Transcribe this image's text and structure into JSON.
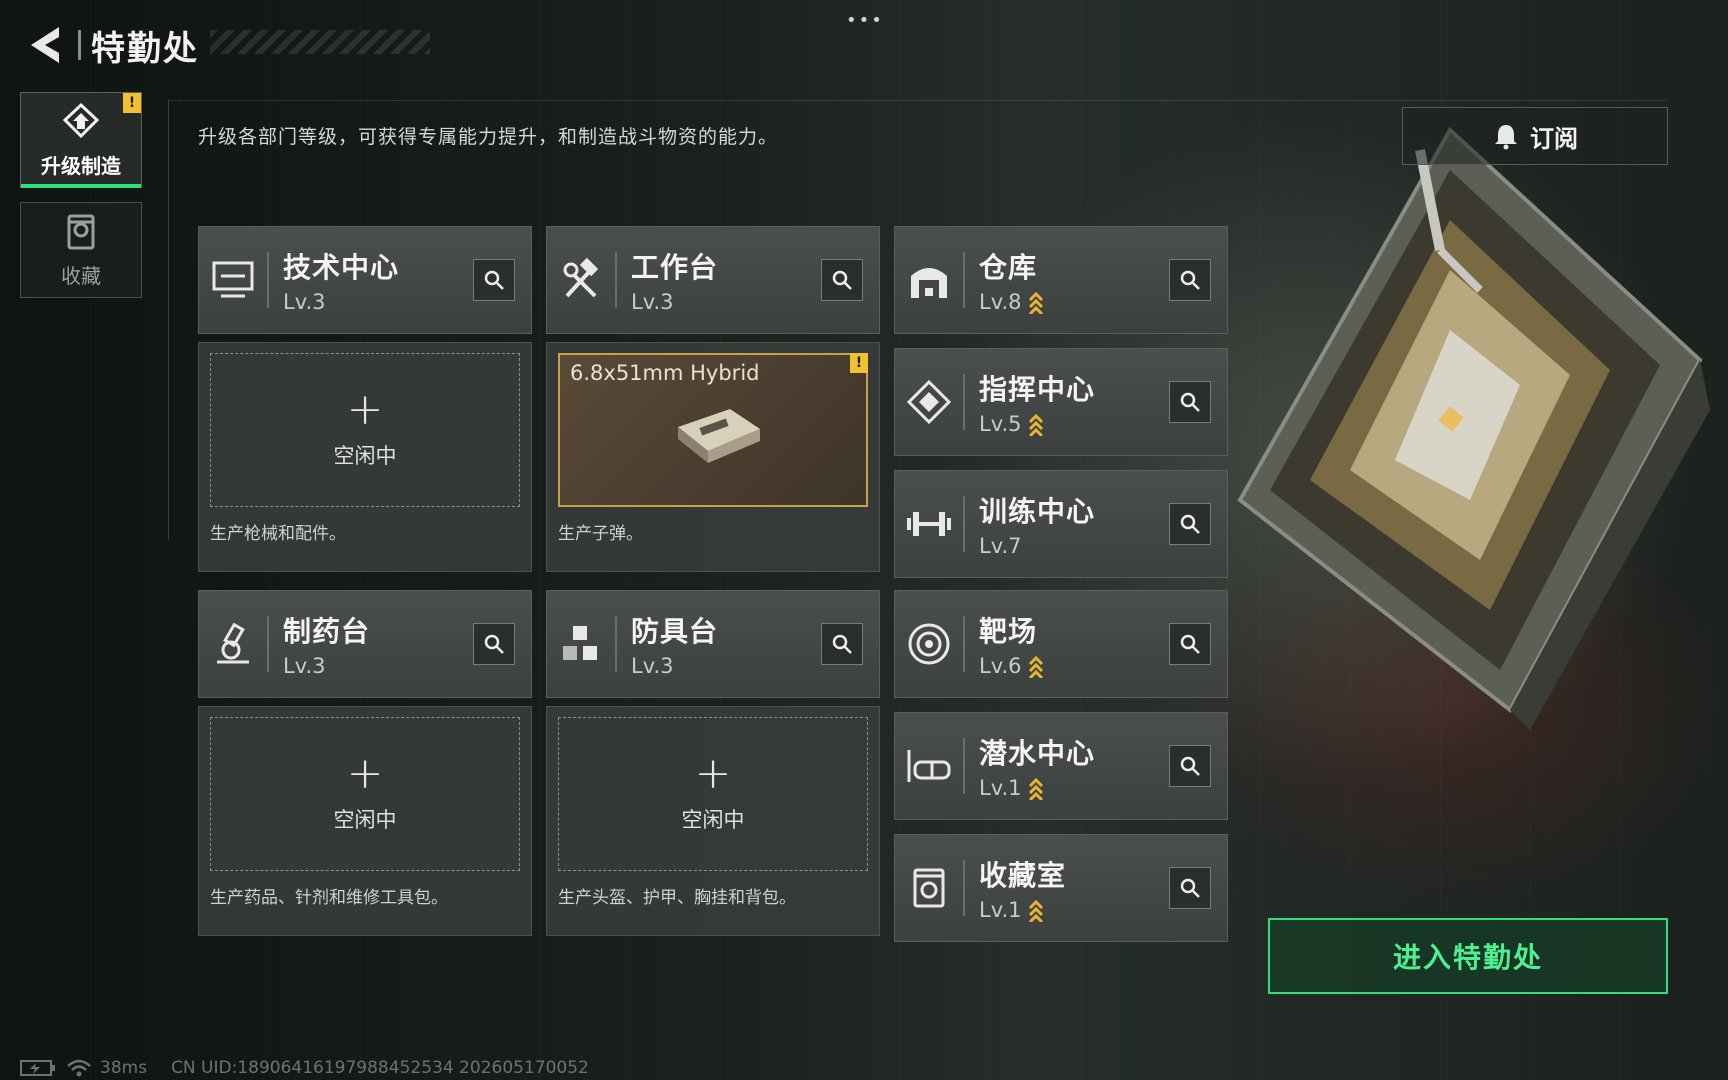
{
  "header": {
    "title": "特勤处"
  },
  "sidebar": {
    "tabs": [
      {
        "label": "升级制造",
        "icon": "upgrade-icon",
        "badge": "!"
      },
      {
        "label": "收藏",
        "icon": "collection-icon"
      }
    ]
  },
  "description": "升级各部门等级，可获得专属能力提升，和制造战斗物资的能力。",
  "subscribe_label": "订阅",
  "stations": [
    {
      "name": "技术中心",
      "level": "Lv.3",
      "icon": "computer-icon",
      "body": {
        "state": "空闲中",
        "desc": "生产枪械和配件。"
      }
    },
    {
      "name": "工作台",
      "level": "Lv.3",
      "icon": "hammer-wrench-icon",
      "body": {
        "item": "6.8x51mm Hybrid",
        "badge": "!",
        "desc": "生产子弹。"
      }
    },
    {
      "name": "制药台",
      "level": "Lv.3",
      "icon": "microscope-icon",
      "body": {
        "state": "空闲中",
        "desc": "生产药品、针剂和维修工具包。"
      }
    },
    {
      "name": "防具台",
      "level": "Lv.3",
      "icon": "blocks-icon",
      "body": {
        "state": "空闲中",
        "desc": "生产头盔、护甲、胸挂和背包。"
      }
    }
  ],
  "facilities": [
    {
      "name": "仓库",
      "level": "Lv.8",
      "upgradable": true,
      "icon": "warehouse-icon"
    },
    {
      "name": "指挥中心",
      "level": "Lv.5",
      "upgradable": true,
      "icon": "command-icon"
    },
    {
      "name": "训练中心",
      "level": "Lv.7",
      "upgradable": false,
      "icon": "dumbbell-icon"
    },
    {
      "name": "靶场",
      "level": "Lv.6",
      "upgradable": true,
      "icon": "target-icon"
    },
    {
      "name": "潜水中心",
      "level": "Lv.1",
      "upgradable": true,
      "icon": "diving-mask-icon"
    },
    {
      "name": "收藏室",
      "level": "Lv.1",
      "upgradable": true,
      "icon": "collection-room-icon"
    }
  ],
  "enter_button": "进入特勤处",
  "status": {
    "ping": "38ms",
    "uid": "CN UID:18906416197988452534 202605170052"
  },
  "colors": {
    "accent": "#2ee07a",
    "badge": "#f2c22c",
    "upgrade": "#e8b530"
  }
}
